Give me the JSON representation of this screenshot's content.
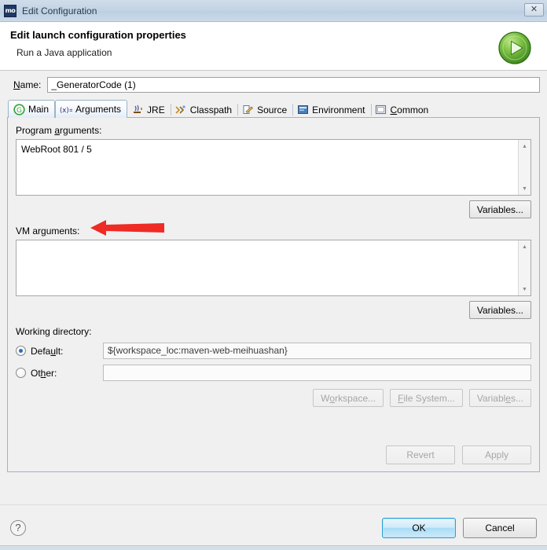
{
  "window": {
    "title": "Edit Configuration",
    "app_icon": "mo",
    "close_label": "✕"
  },
  "header": {
    "title": "Edit launch configuration properties",
    "subtitle": "Run a Java application",
    "run_icon": "run-play-icon"
  },
  "name_field": {
    "label": "Name:",
    "label_accel": "N",
    "value": "_GeneratorCode (1)",
    "placeholder": ""
  },
  "tabs": [
    {
      "label": "Main",
      "icon": "java-main-icon",
      "icon_glyph": "G",
      "active": false
    },
    {
      "label": "Arguments",
      "icon": "arguments-icon",
      "icon_glyph": "(x)=",
      "active": true
    },
    {
      "label": "JRE",
      "icon": "jre-icon",
      "icon_glyph": "☕",
      "active": false
    },
    {
      "label": "Classpath",
      "icon": "classpath-icon",
      "icon_glyph": "⑂",
      "active": false
    },
    {
      "label": "Source",
      "icon": "source-icon",
      "icon_glyph": "✎",
      "active": false
    },
    {
      "label": "Environment",
      "icon": "environment-icon",
      "icon_glyph": "▣",
      "active": false
    },
    {
      "label": "Common",
      "icon": "common-icon",
      "icon_glyph": "□",
      "active": false
    }
  ],
  "program_arguments": {
    "label": "Program arguments:",
    "value": "WebRoot 801 / 5",
    "variables_button": "Variables..."
  },
  "vm_arguments": {
    "label": "VM arguments:",
    "value": "",
    "variables_button": "Variables..."
  },
  "working_directory": {
    "label": "Working directory:",
    "default_radio_label": "Default:",
    "default_selected": true,
    "default_value": "${workspace_loc:maven-web-meihuashan}",
    "other_radio_label": "Other:",
    "other_selected": false,
    "other_value": "",
    "buttons": [
      {
        "label": "Workspace...",
        "disabled": true
      },
      {
        "label": "File System...",
        "disabled": true
      },
      {
        "label": "Variables...",
        "disabled": true
      }
    ]
  },
  "form_actions": {
    "revert": "Revert",
    "apply": "Apply",
    "revert_disabled": true,
    "apply_disabled": true
  },
  "footer": {
    "help_glyph": "?",
    "ok": "OK",
    "cancel": "Cancel"
  },
  "annotation": {
    "type": "red-arrow",
    "color": "#ee2b24",
    "points_to": "WebRoot 801 / 5"
  },
  "colors": {
    "accent": "#2a9fd6",
    "annotation_red": "#ee2b24",
    "radio_blue": "#2a6ebb",
    "title_bar": "#c4d4e4"
  }
}
